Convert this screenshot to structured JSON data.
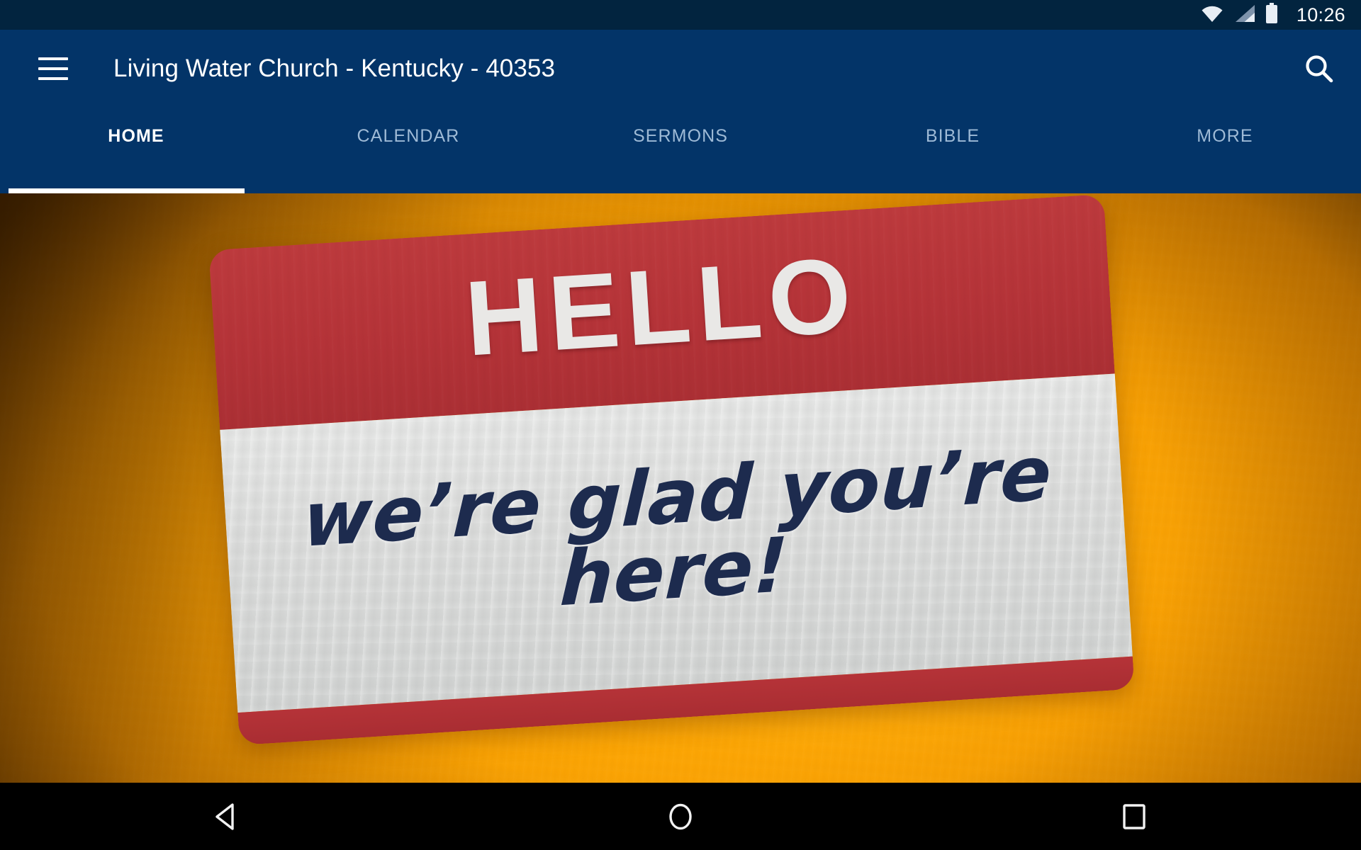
{
  "status_bar": {
    "time": "10:26",
    "icons": [
      "wifi-icon",
      "cellular-signal-icon",
      "battery-icon"
    ]
  },
  "app_bar": {
    "menu_icon": "hamburger-menu-icon",
    "title": "Living Water Church - Kentucky - 40353",
    "search_icon": "search-icon"
  },
  "tabs": {
    "active_index": 0,
    "items": [
      {
        "label": "HOME"
      },
      {
        "label": "CALENDAR"
      },
      {
        "label": "SERMONS"
      },
      {
        "label": "BIBLE"
      },
      {
        "label": "MORE"
      }
    ]
  },
  "hero": {
    "name_tag": {
      "heading": "HELLO",
      "message": "we’re glad you’re here!"
    }
  },
  "navigation_bar": {
    "back_icon": "back-triangle-icon",
    "home_icon": "home-circle-icon",
    "recents_icon": "recents-square-icon"
  },
  "colors": {
    "app_bar_blue": "#033468",
    "status_bar_blue": "#02243f",
    "tab_inactive": "#9ebad6",
    "tab_active": "#ffffff",
    "hero_orange": "#f9a503",
    "tag_red": "#b53338",
    "tag_white": "#dcdddc",
    "tag_text_navy": "#1d2b4e",
    "nav_bar_black": "#000000"
  }
}
